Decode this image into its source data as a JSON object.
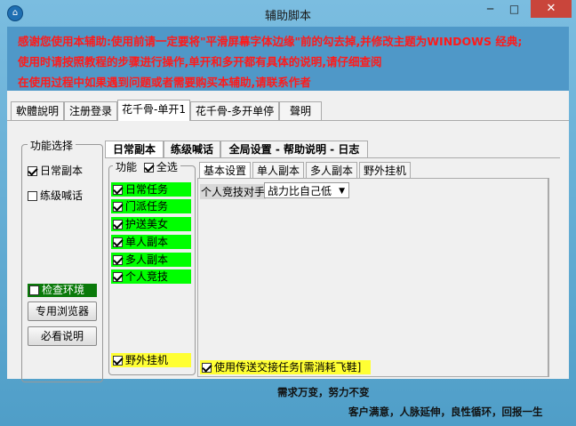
{
  "window": {
    "title": "辅助脚本",
    "minimize": "─",
    "maximize": "□",
    "close": "✕",
    "app_icon": "home-icon"
  },
  "notices": [
    "感谢您使用本辅助:使用前请一定要将\"平滑屏幕字体边缘\"前的勾去掉,并修改主题为WINDOWS 经典;",
    "使用时请按照教程的步骤进行操作,单开和多开都有具体的说明,请仔细查阅",
    "在使用过程中如果遇到问题或者需要购买本辅助,请联系作者"
  ],
  "tabs": [
    "軟體說明",
    "注册登录",
    "花千骨-单开1",
    "花千骨-多开单停",
    "聲明"
  ],
  "left_panel": {
    "legend": "功能选择",
    "daily": "日常副本",
    "leveling": "练级喊话",
    "check_env": "检查环境",
    "browser_btn": "专用浏览器",
    "help_btn": "必看说明"
  },
  "inner_tabs": [
    "日常副本",
    "练级喊话",
    "全局设置 - 帮助说明 - 日志"
  ],
  "functions": {
    "legend": "功能",
    "select_all": "全选",
    "items": [
      "日常任务",
      "门派任务",
      "护送美女",
      "单人副本",
      "多人副本",
      "个人竞技"
    ],
    "field_hangup": "野外挂机"
  },
  "settings_tabs": [
    "基本设置",
    "单人副本",
    "多人副本",
    "野外挂机"
  ],
  "basic": {
    "opponent_label": "个人竞技对手",
    "opponent_value": "战力比自己低",
    "teleport_label": "使用传送交接任务[需消耗飞鞋]"
  },
  "footer": {
    "line1": "需求万变，努力不变",
    "line2": "客户满意，人脉延伸，良性循环，回报一生"
  }
}
